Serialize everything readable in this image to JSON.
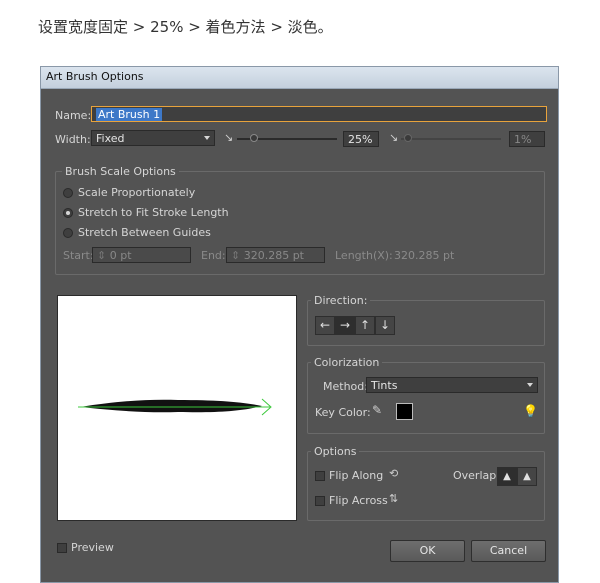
{
  "caption": "设置宽度固定 > 25%  > 着色方法 > 淡色。",
  "window": {
    "title": "Art Brush Options"
  },
  "name_row": {
    "label": "Name:",
    "value": "Art Brush 1"
  },
  "width_row": {
    "label": "Width:",
    "select": "Fixed",
    "percent_left": "25%",
    "percent_right": "1%"
  },
  "scale": {
    "title": "Brush Scale Options",
    "options": [
      "Scale Proportionately",
      "Stretch to Fit Stroke Length",
      "Stretch Between Guides"
    ],
    "selected_index": 1,
    "start_label": "Start:",
    "start_value": "0 pt",
    "end_label": "End:",
    "end_value": "320.285 pt",
    "length_label": "Length(X):",
    "length_value": "320.285 pt"
  },
  "direction": {
    "title": "Direction:",
    "buttons": [
      "←",
      "→",
      "↑",
      "↓"
    ],
    "selected_index": 1
  },
  "colorization": {
    "title": "Colorization",
    "method_label": "Method:",
    "method_value": "Tints",
    "key_color_label": "Key Color:",
    "key_color": "#000000"
  },
  "options": {
    "title": "Options",
    "flip_along": "Flip Along",
    "flip_across": "Flip Across",
    "overlap_label": "Overlap:"
  },
  "preview_label": "Preview",
  "buttons": {
    "ok": "OK",
    "cancel": "Cancel"
  },
  "colors": {
    "dialog_bg": "#535353",
    "field_bg": "#3f3f3f",
    "accent": "#e8a33c",
    "brush_guide": "#3cc83c"
  }
}
